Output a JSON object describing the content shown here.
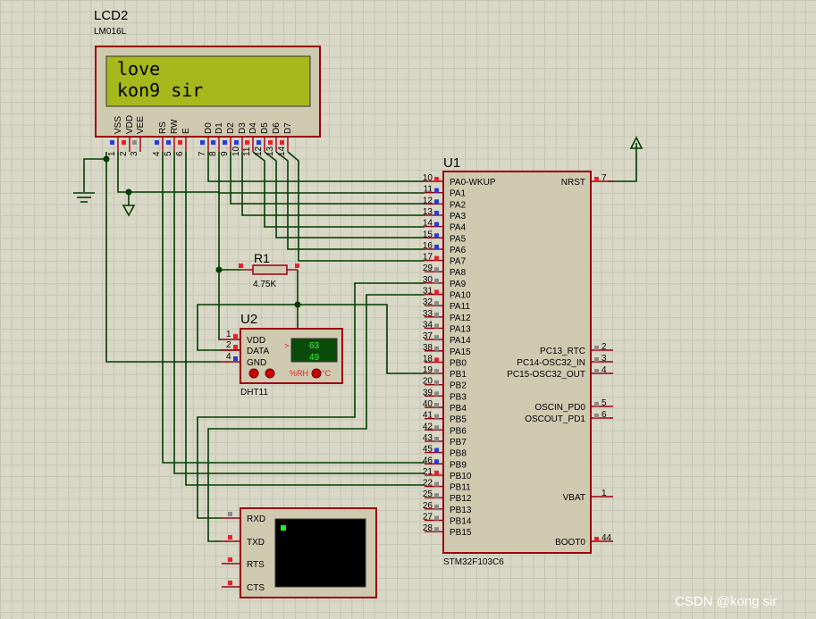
{
  "lcd": {
    "ref": "LCD2",
    "model": "LM016L",
    "line1": "love",
    "line2": "kon9 sir",
    "pins": [
      {
        "name": "VSS",
        "num": "1"
      },
      {
        "name": "VDD",
        "num": "2"
      },
      {
        "name": "VEE",
        "num": "3"
      },
      {
        "name": "RS",
        "num": "4"
      },
      {
        "name": "RW",
        "num": "5"
      },
      {
        "name": "E",
        "num": "6"
      },
      {
        "name": "D0",
        "num": "7"
      },
      {
        "name": "D1",
        "num": "8"
      },
      {
        "name": "D2",
        "num": "9"
      },
      {
        "name": "D3",
        "num": "10"
      },
      {
        "name": "D4",
        "num": "11"
      },
      {
        "name": "D5",
        "num": "12"
      },
      {
        "name": "D6",
        "num": "13"
      },
      {
        "name": "D7",
        "num": "14"
      }
    ]
  },
  "mcu": {
    "ref": "U1",
    "model": "STM32F103C6",
    "left_pins": [
      {
        "num": "10",
        "name": "PA0-WKUP"
      },
      {
        "num": "11",
        "name": "PA1"
      },
      {
        "num": "12",
        "name": "PA2"
      },
      {
        "num": "13",
        "name": "PA3"
      },
      {
        "num": "14",
        "name": "PA4"
      },
      {
        "num": "15",
        "name": "PA5"
      },
      {
        "num": "16",
        "name": "PA6"
      },
      {
        "num": "17",
        "name": "PA7"
      },
      {
        "num": "29",
        "name": "PA8"
      },
      {
        "num": "30",
        "name": "PA9"
      },
      {
        "num": "31",
        "name": "PA10"
      },
      {
        "num": "32",
        "name": "PA11"
      },
      {
        "num": "33",
        "name": "PA12"
      },
      {
        "num": "34",
        "name": "PA13"
      },
      {
        "num": "37",
        "name": "PA14"
      },
      {
        "num": "38",
        "name": "PA15"
      },
      {
        "num": "18",
        "name": "PB0"
      },
      {
        "num": "19",
        "name": "PB1"
      },
      {
        "num": "20",
        "name": "PB2"
      },
      {
        "num": "39",
        "name": "PB3"
      },
      {
        "num": "40",
        "name": "PB4"
      },
      {
        "num": "41",
        "name": "PB5"
      },
      {
        "num": "42",
        "name": "PB6"
      },
      {
        "num": "43",
        "name": "PB7"
      },
      {
        "num": "45",
        "name": "PB8"
      },
      {
        "num": "46",
        "name": "PB9"
      },
      {
        "num": "21",
        "name": "PB10"
      },
      {
        "num": "22",
        "name": "PB11"
      },
      {
        "num": "25",
        "name": "PB12"
      },
      {
        "num": "26",
        "name": "PB13"
      },
      {
        "num": "27",
        "name": "PB14"
      },
      {
        "num": "28",
        "name": "PB15"
      }
    ],
    "right_pins": [
      {
        "num": "7",
        "name": "NRST"
      },
      {
        "num": "2",
        "name": "PC13_RTC"
      },
      {
        "num": "3",
        "name": "PC14-OSC32_IN"
      },
      {
        "num": "4",
        "name": "PC15-OSC32_OUT"
      },
      {
        "num": "5",
        "name": "OSCIN_PD0"
      },
      {
        "num": "6",
        "name": "OSCOUT_PD1"
      },
      {
        "num": "1",
        "name": "VBAT"
      },
      {
        "num": "44",
        "name": "BOOT0"
      }
    ]
  },
  "resistor": {
    "ref": "R1",
    "value": "4.75K"
  },
  "sensor": {
    "ref": "U2",
    "model": "DHT11",
    "pins": [
      {
        "num": "1",
        "name": "VDD"
      },
      {
        "num": "2",
        "name": "DATA"
      },
      {
        "num": "4",
        "name": "GND"
      }
    ],
    "display_top": "63",
    "display_bottom": "49",
    "display_arrow": ">",
    "rh_label": "%RH",
    "deg_symbol": "°C"
  },
  "terminal": {
    "pins": [
      {
        "name": "RXD"
      },
      {
        "name": "TXD"
      },
      {
        "name": "RTS"
      },
      {
        "name": "CTS"
      }
    ]
  },
  "watermark": "CSDN @kong sir",
  "colors": {
    "wire": "#003c00",
    "outline": "#9a0010",
    "lcd_screen": "#a6b81c",
    "sensor_display": "#0a4a0a",
    "sensor_digits": "#33ff33"
  }
}
